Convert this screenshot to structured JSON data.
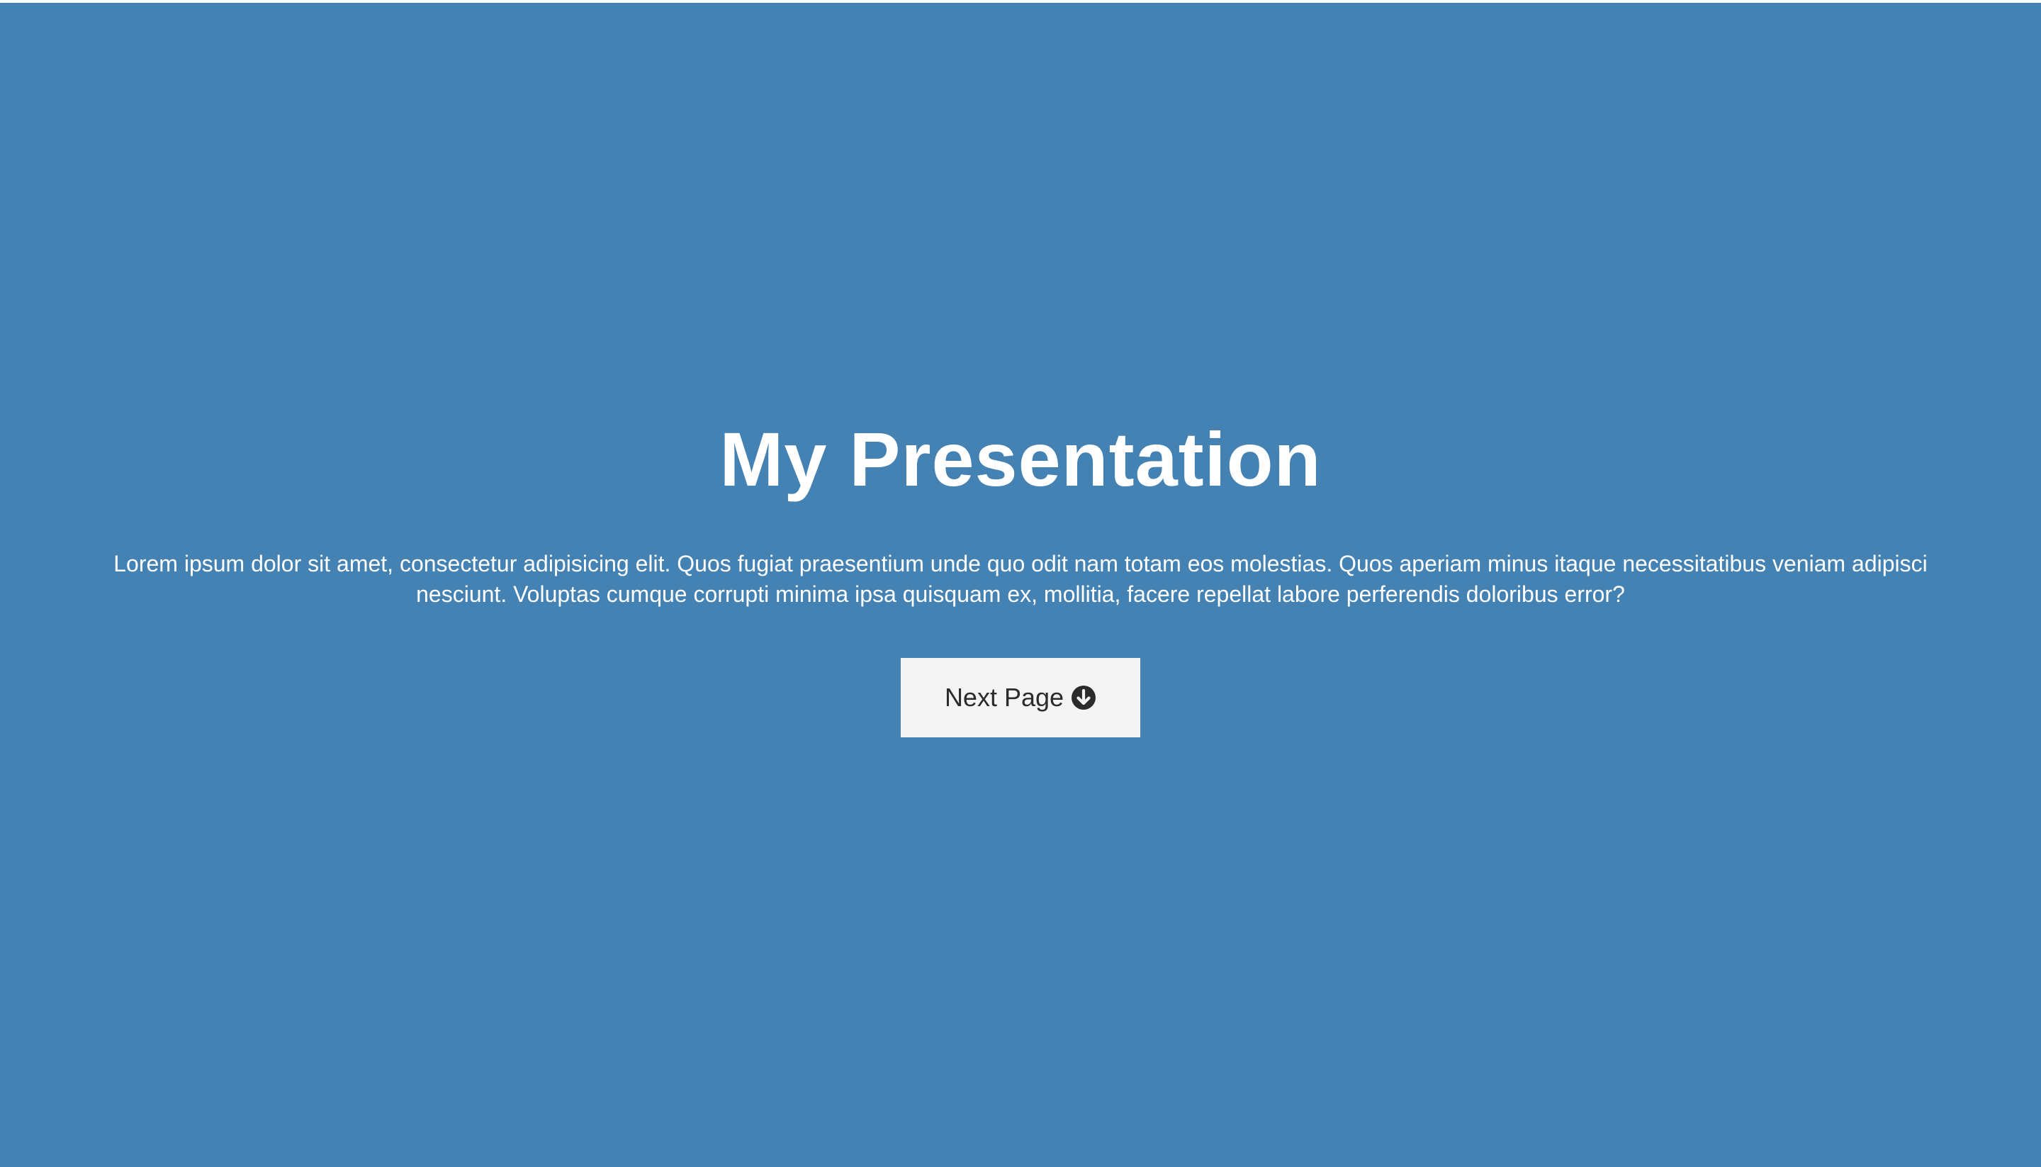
{
  "slide": {
    "background_color": "#4482b4",
    "title": "My Presentation",
    "body": "Lorem ipsum dolor sit amet, consectetur adipisicing elit. Quos fugiat praesentium unde quo odit nam totam eos molestias. Quos aperiam minus itaque necessitatibus veniam adipisci nesciunt. Voluptas cumque corrupti minima ipsa quisquam ex, mollitia, facere repellat labore perferendis doloribus error?",
    "next_button": {
      "label": "Next Page",
      "icon": "arrow-circle-down-icon",
      "background_color": "#f4f4f4",
      "text_color": "#2b2b2b"
    }
  }
}
